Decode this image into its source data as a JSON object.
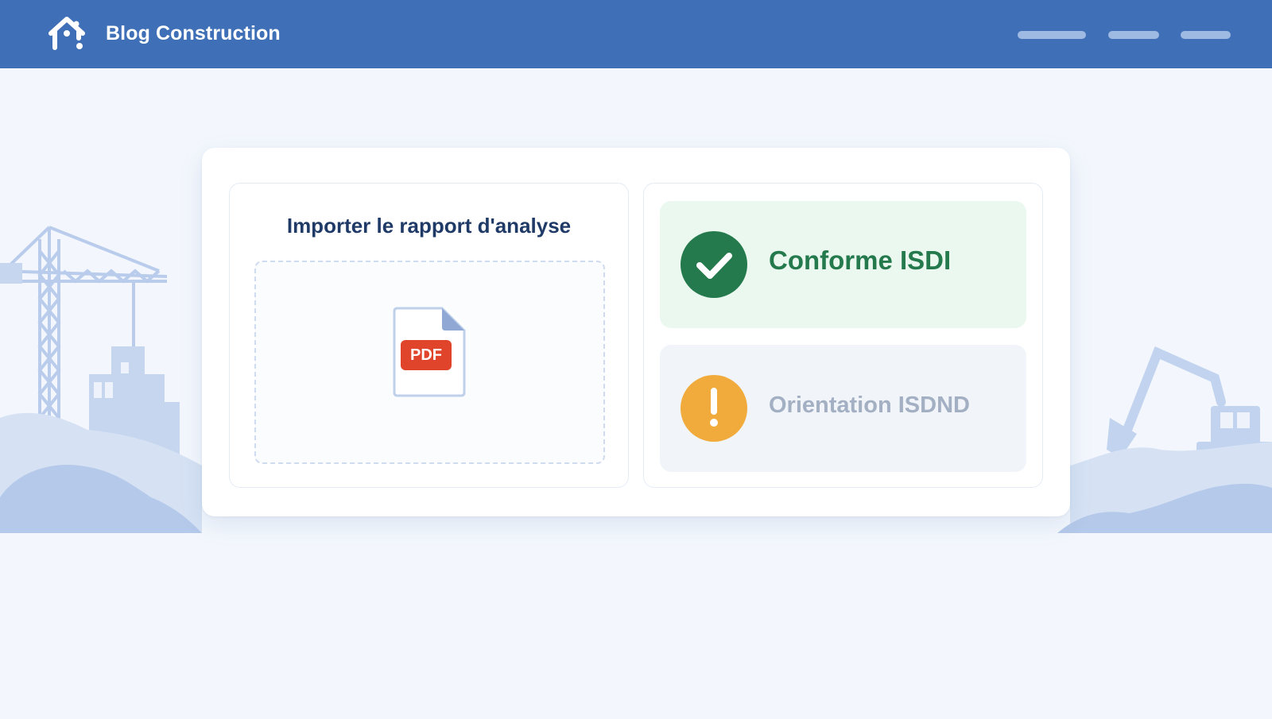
{
  "header": {
    "brand": "Blog Construction",
    "logo_icon": "house-icon",
    "nav_items": [
      "nav-placeholder-1",
      "nav-placeholder-2",
      "nav-placeholder-3"
    ],
    "color": "#3f6fb6"
  },
  "upload": {
    "title": "Importer le rapport d'analyse",
    "file_badge": "PDF",
    "file_icon": "pdf-file-icon",
    "badge_color": "#e0452c"
  },
  "results": {
    "compliant": {
      "label": "Conforme ISDI",
      "icon": "check-circle-icon",
      "color": "#247a4d"
    },
    "orientation": {
      "label": "Orientation ISDND",
      "icon": "exclamation-circle-icon",
      "color": "#f0ab3c"
    }
  },
  "background": {
    "left_illustration": "construction-crane-illustration",
    "right_illustration": "excavator-illustration"
  }
}
